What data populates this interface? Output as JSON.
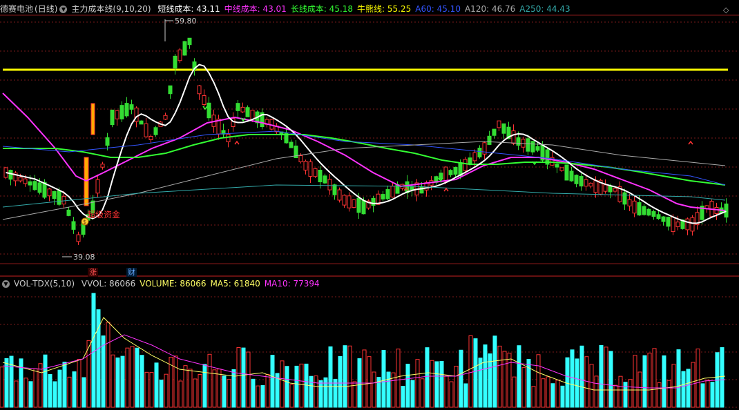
{
  "main_header": {
    "stock": "德赛电池",
    "period": "(日线)",
    "indicator": "主力成本线(9,10,20)",
    "items": [
      {
        "label": "短线成本:",
        "value": "43.11",
        "color": "#ffffff"
      },
      {
        "label": "中线成本:",
        "value": "43.01",
        "color": "#ff33ff"
      },
      {
        "label": "长线成本:",
        "value": "45.18",
        "color": "#33ff33"
      },
      {
        "label": "牛熊线:",
        "value": "55.25",
        "color": "#ffff00"
      },
      {
        "label": "A60:",
        "value": "45.10",
        "color": "#3355ff"
      },
      {
        "label": "A120:",
        "value": "46.76",
        "color": "#aaaaaa"
      },
      {
        "label": "A250:",
        "value": "44.43",
        "color": "#33aaaa"
      }
    ]
  },
  "price_annotations": {
    "high": "59.80",
    "low": "39.08",
    "signal_text": "超级资金",
    "signal_badge": "$",
    "rise_marker": "涨",
    "finance_marker": "财"
  },
  "volume_header": {
    "indicator": "VOL-TDX(5,10)",
    "items": [
      {
        "label": "VVOL:",
        "value": "86066",
        "color": "#cccccc"
      },
      {
        "label": "VOLUME:",
        "value": "86066",
        "color": "#ffff66"
      },
      {
        "label": "MA5:",
        "value": "61840",
        "color": "#ffff66"
      },
      {
        "label": "MA10:",
        "value": "77394",
        "color": "#ff33ff"
      }
    ]
  },
  "colors": {
    "up": "#ff3333",
    "down": "#33ffff",
    "down_candle": "#33dd33",
    "grid": "#7a1a1a",
    "bull_bear": "#ffff00"
  }
}
